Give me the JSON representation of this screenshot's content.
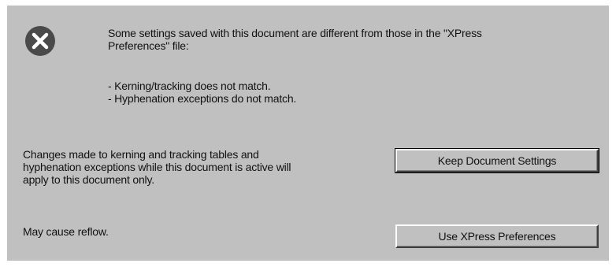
{
  "dialog": {
    "icon": "error-x-icon",
    "message_lines": [
      "Some settings saved with this document are different from those in the \"XPress",
      "Preferences\" file:"
    ],
    "mismatch_lines": [
      "- Kerning/tracking does not match.",
      "- Hyphenation exceptions do not match."
    ],
    "info_lines": [
      "Changes made to kerning and tracking tables and",
      "hyphenation exceptions while this document is active will",
      "apply to this document only."
    ],
    "reflow_note": "May cause reflow.",
    "buttons": {
      "keep_label": "Keep Document Settings",
      "use_label": "Use XPress Preferences"
    }
  }
}
